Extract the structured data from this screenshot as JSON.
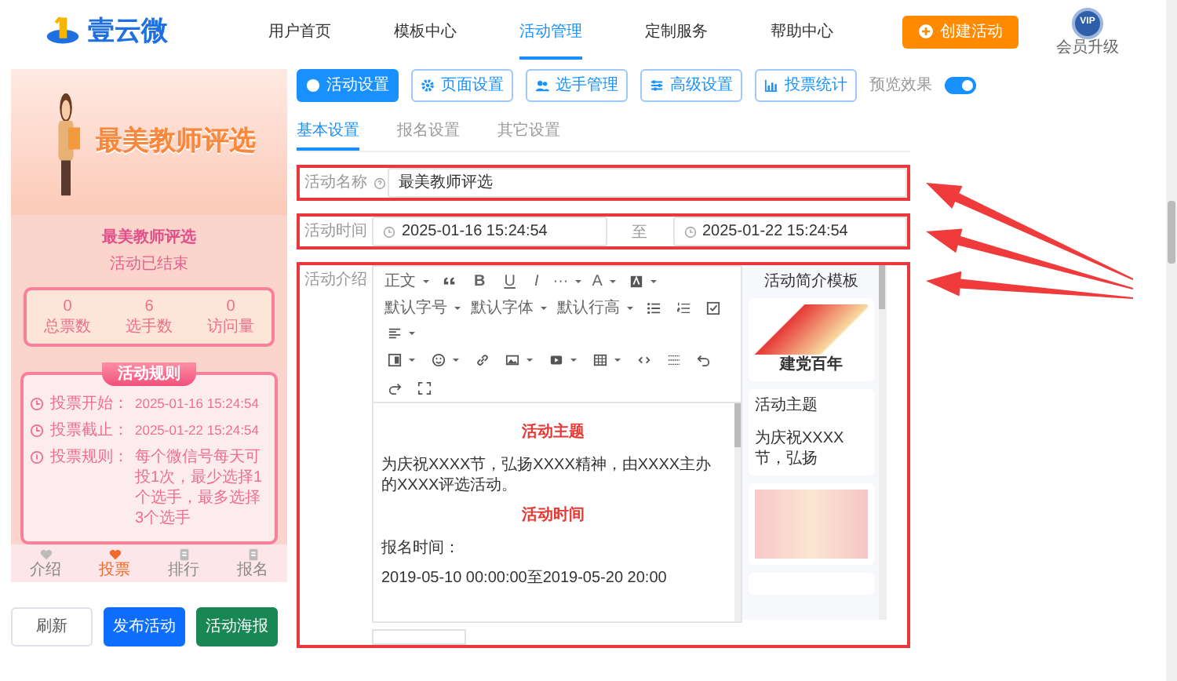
{
  "navbar": {
    "logo_text": "壹云微",
    "items": [
      {
        "label": "用户首页",
        "selected": false
      },
      {
        "label": "模板中心",
        "selected": false
      },
      {
        "label": "活动管理",
        "selected": true
      },
      {
        "label": "定制服务",
        "selected": false
      },
      {
        "label": "帮助中心",
        "selected": false
      }
    ],
    "create_button": "创建活动",
    "vip_badge": "VIP",
    "vip_label": "会员升级"
  },
  "preview": {
    "banner_title": "最美教师评选",
    "title": "最美教师评选",
    "status": "活动已结束",
    "stats": [
      {
        "value": "0",
        "label": "总票数"
      },
      {
        "value": "6",
        "label": "选手数"
      },
      {
        "value": "0",
        "label": "访问量"
      }
    ],
    "rules": {
      "title": "活动规则",
      "items": [
        {
          "label": "投票开始：",
          "value": "2025-01-16 15:24:54"
        },
        {
          "label": "投票截止：",
          "value": "2025-01-22 15:24:54"
        },
        {
          "label": "投票规则：",
          "value": "每个微信号每天可投1次，最少选择1个选手，最多选择3个选手"
        }
      ]
    },
    "tabbar": [
      {
        "label": "介绍",
        "selected": false
      },
      {
        "label": "投票",
        "selected": true
      },
      {
        "label": "排行",
        "selected": false
      },
      {
        "label": "报名",
        "selected": false
      }
    ]
  },
  "preview_buttons": [
    {
      "label": "刷新",
      "kind": "outline"
    },
    {
      "label": "发布活动",
      "kind": "primary"
    },
    {
      "label": "活动海报",
      "kind": "success"
    }
  ],
  "settings_buttons": [
    {
      "label": "活动设置",
      "selected": true
    },
    {
      "label": "页面设置",
      "selected": false
    },
    {
      "label": "选手管理",
      "selected": false
    },
    {
      "label": "高级设置",
      "selected": false
    },
    {
      "label": "投票统计",
      "selected": false
    }
  ],
  "preview_toggle": {
    "label": "预览效果",
    "on": true
  },
  "sub_tabs": [
    {
      "label": "基本设置",
      "selected": true
    },
    {
      "label": "报名设置",
      "selected": false
    },
    {
      "label": "其它设置",
      "selected": false
    }
  ],
  "form": {
    "name": {
      "label": "活动名称",
      "value": "最美教师评选",
      "highlighted": true
    },
    "time": {
      "label": "活动时间",
      "start": "2025-01-16 15:24:54",
      "separator": "至",
      "end": "2025-01-22 15:24:54",
      "highlighted": true
    },
    "intro": {
      "label": "活动介绍",
      "highlighted": true,
      "toolbar": [
        [
          {
            "kind": "menu",
            "label": "正文"
          },
          {
            "kind": "icon"
          },
          {
            "kind": "format",
            "label": "B"
          },
          {
            "kind": "format",
            "label": "U"
          },
          {
            "kind": "format",
            "label": "I"
          },
          {
            "kind": "menu",
            "label": "···"
          },
          {
            "kind": "menu",
            "label": "A"
          },
          {
            "kind": "icon"
          }
        ],
        [
          {
            "kind": "menu",
            "label": "默认字号"
          },
          {
            "kind": "menu",
            "label": "默认字体"
          },
          {
            "kind": "menu",
            "label": "默认行高"
          },
          {
            "kind": "icon"
          },
          {
            "kind": "icon"
          },
          {
            "kind": "icon"
          },
          {
            "kind": "icon"
          }
        ],
        [
          {
            "kind": "icon"
          },
          {
            "kind": "icon"
          },
          {
            "kind": "icon"
          },
          {
            "kind": "icon"
          },
          {
            "kind": "icon"
          },
          {
            "kind": "icon"
          },
          {
            "kind": "icon"
          },
          {
            "kind": "icon"
          },
          {
            "kind": "icon"
          }
        ],
        [
          {
            "kind": "icon"
          },
          {
            "kind": "icon"
          }
        ]
      ],
      "content": [
        {
          "kind": "heading",
          "text": "活动主题"
        },
        {
          "kind": "paragraph",
          "text": "为庆祝XXXX节，弘扬XXXX精神，由XXXX主办的XXXX评选活动。"
        },
        {
          "kind": "heading",
          "text": "活动时间"
        },
        {
          "kind": "paragraph",
          "text": "报名时间："
        },
        {
          "kind": "paragraph",
          "text": "2019-05-10 00:00:00至2019-05-20 20:00"
        }
      ],
      "templates": {
        "title": "活动简介模板",
        "items": [
          {
            "kind": "image",
            "caption": "建党百年"
          },
          {
            "kind": "text",
            "title": "活动主题",
            "excerpt": "为庆祝XXXX节，弘扬"
          },
          {
            "kind": "image"
          },
          {
            "kind": "blank"
          }
        ]
      }
    }
  }
}
